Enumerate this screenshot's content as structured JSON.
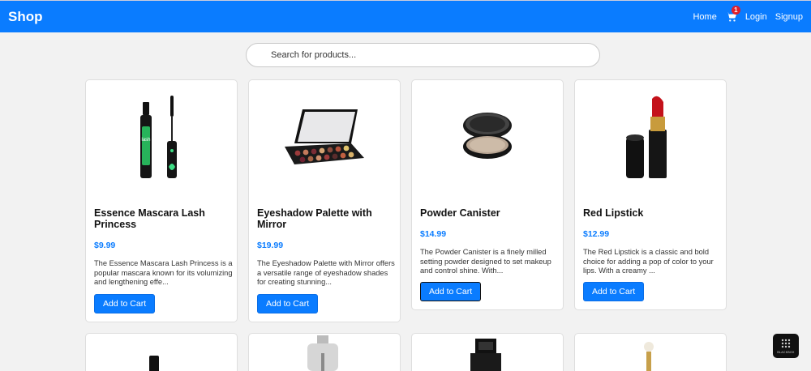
{
  "navbar": {
    "brand": "Shop",
    "links": {
      "home": "Home",
      "login": "Login",
      "signup": "Signup"
    },
    "cart_count": "1"
  },
  "search": {
    "placeholder": "Search for products..."
  },
  "products": [
    {
      "name": "Essence Mascara Lash Princess",
      "price": "$9.99",
      "description": "The Essence Mascara Lash Princess is a popular mascara known for its volumizing and lengthening effe...",
      "button": "Add to Cart",
      "image_icon": "mascara-icon"
    },
    {
      "name": "Eyeshadow Palette with Mirror",
      "price": "$19.99",
      "description": "The Eyeshadow Palette with Mirror offers a versatile range of eyeshadow shades for creating stunning...",
      "button": "Add to Cart",
      "image_icon": "eyeshadow-palette-icon"
    },
    {
      "name": "Powder Canister",
      "price": "$14.99",
      "description": "The Powder Canister is a finely milled setting powder designed to set makeup and control shine. With...",
      "button": "Add to Cart",
      "image_icon": "powder-canister-icon"
    },
    {
      "name": "Red Lipstick",
      "price": "$12.99",
      "description": "The Red Lipstick is a classic and bold choice for adding a pop of color to your lips. With a creamy ...",
      "button": "Add to Cart",
      "image_icon": "lipstick-icon"
    }
  ],
  "lower_row_images": [
    "nail-polish-icon",
    "perfume-bottle-icon",
    "perfume-bottle-icon",
    "perfume-bottle-icon"
  ],
  "colors": {
    "primary": "#0a7cff",
    "badge": "#e01f2d",
    "background": "#f2f2f2"
  }
}
